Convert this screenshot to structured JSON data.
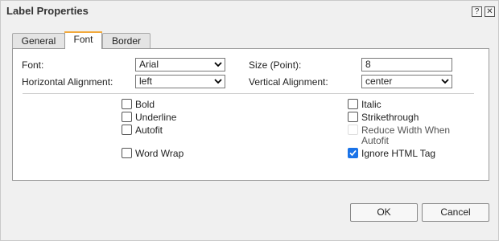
{
  "window": {
    "title": "Label Properties",
    "help_label": "?",
    "close_label": "✕"
  },
  "tabs": [
    {
      "label": "General",
      "active": false
    },
    {
      "label": "Font",
      "active": true
    },
    {
      "label": "Border",
      "active": false
    }
  ],
  "font_tab": {
    "font_label": "Font:",
    "font_value": "Arial",
    "size_label": "Size (Point):",
    "size_value": "8",
    "halign_label": "Horizontal Alignment:",
    "halign_value": "left",
    "valign_label": "Vertical Alignment:",
    "valign_value": "center",
    "options": {
      "bold": {
        "label": "Bold",
        "checked": false
      },
      "underline": {
        "label": "Underline",
        "checked": false
      },
      "autofit": {
        "label": "Autofit",
        "checked": false
      },
      "word_wrap": {
        "label": "Word Wrap",
        "checked": false
      },
      "italic": {
        "label": "Italic",
        "checked": false
      },
      "strikethrough": {
        "label": "Strikethrough",
        "checked": false
      },
      "reduce_width_line1": "Reduce Width When",
      "reduce_width_line2": "Autofit",
      "reduce_width_enabled": false,
      "ignore_html": {
        "label": "Ignore HTML Tag",
        "checked": true
      }
    }
  },
  "buttons": {
    "ok": "OK",
    "cancel": "Cancel"
  },
  "colors": {
    "accent": "#1a73e8",
    "active_tab_marker": "#f2a93b"
  }
}
